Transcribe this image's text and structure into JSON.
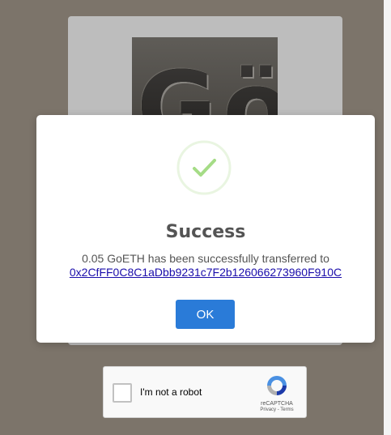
{
  "background": {
    "logo_text": "Gö"
  },
  "modal": {
    "icon": "checkmark-circle-icon",
    "title": "Success",
    "message": "0.05 GoETH has been successfully transferred to",
    "address": "0x2CfFF0C8C1aDbb9231c7F2b126066273960F910C",
    "ok_label": "OK"
  },
  "captcha": {
    "label": "I'm not a robot",
    "brand": "reCAPTCHA",
    "links": "Privacy - Terms",
    "icon": "recaptcha-logo-icon"
  },
  "colors": {
    "accent": "#2a7bd8",
    "success": "#a5dc86",
    "link": "#1a0dab",
    "overlay": "#7c746a"
  }
}
